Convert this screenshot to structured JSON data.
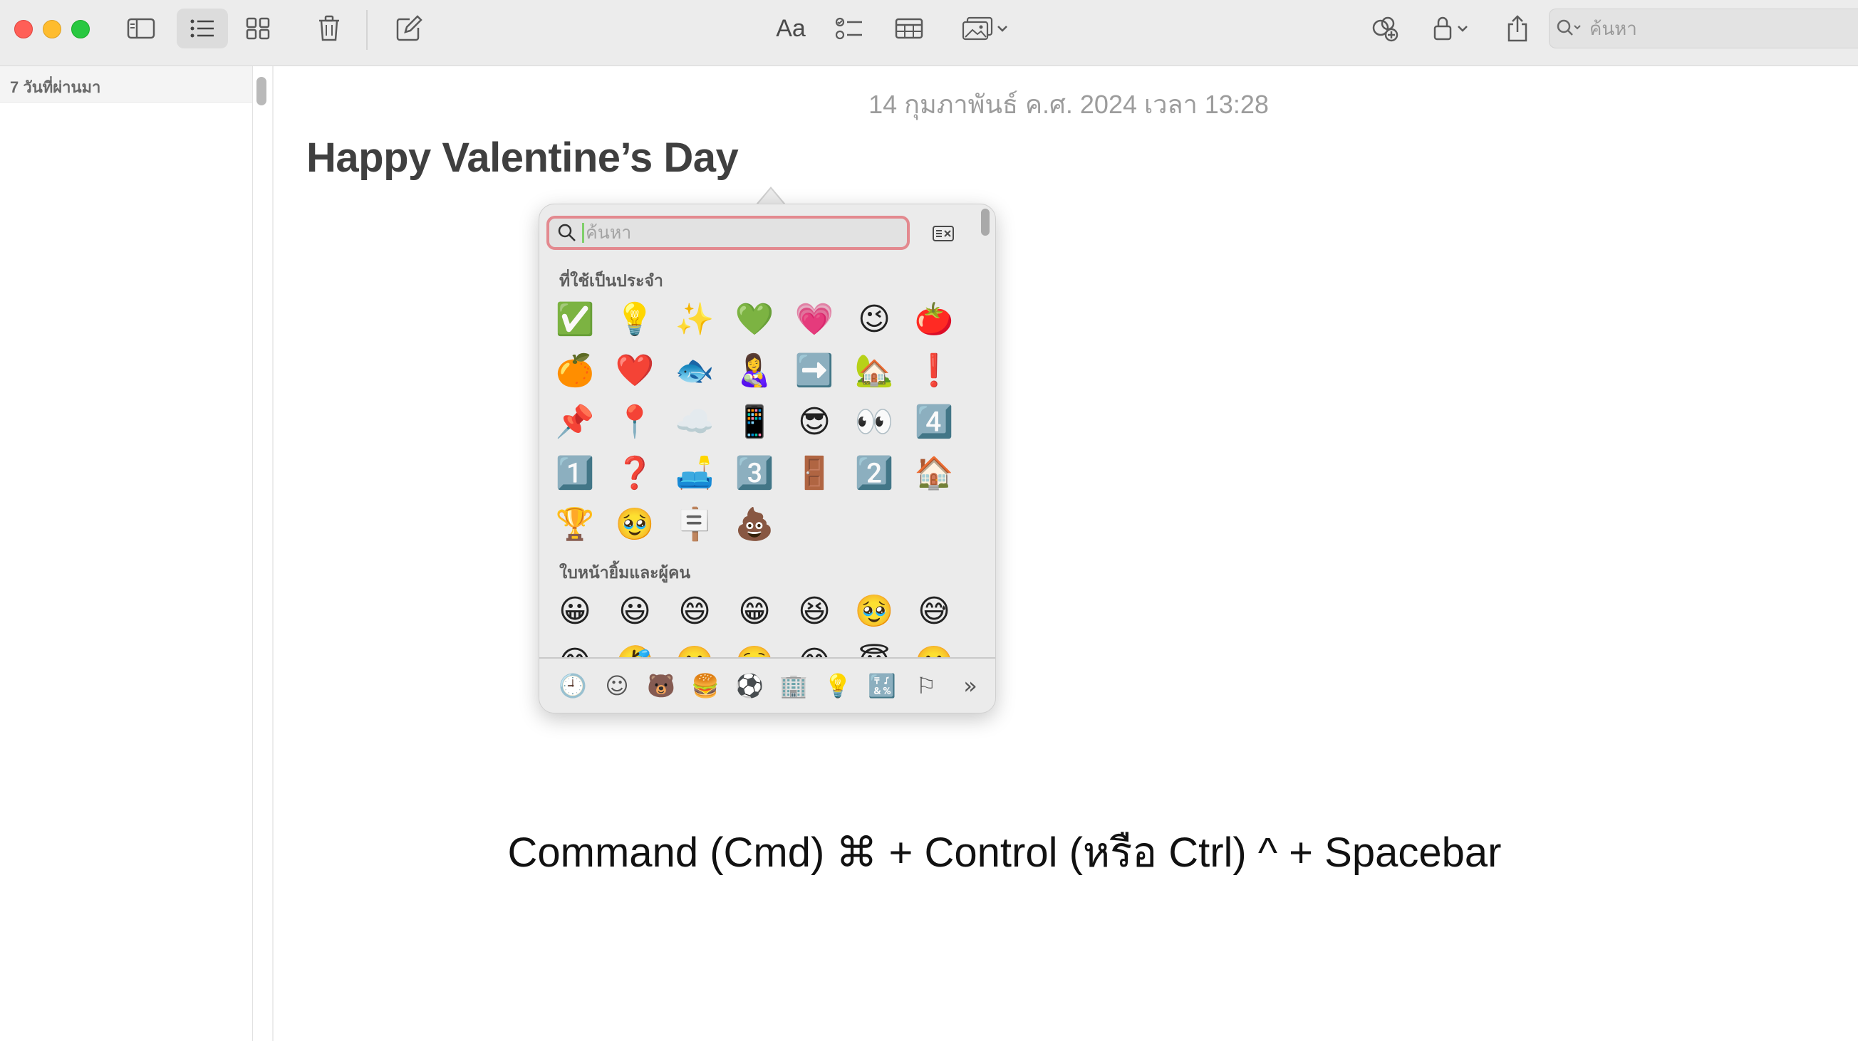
{
  "toolbar": {
    "search_placeholder": "ค้นหา",
    "format_label": "Aa"
  },
  "sidebar": {
    "section_header": "7 วันที่ผ่านมา"
  },
  "note": {
    "date": "14 กุมภาพันธ์ ค.ศ. 2024 เวลา 13:28",
    "title": "Happy Valentine’s Day",
    "shortcut_text": "Command (Cmd) ⌘ + Control (หรือ Ctrl) ^ + Spacebar"
  },
  "emoji_picker": {
    "search_placeholder": "ค้นหา",
    "sections": [
      {
        "label": "ที่ใช้เป็นประจำ",
        "emojis": [
          "✅",
          "💡",
          "✨",
          "💚",
          "💗",
          "😉",
          "🍅",
          "🍊",
          "❤️",
          "🐟",
          "👩‍🍼",
          "➡️",
          "🏡",
          "❗",
          "📌",
          "📍",
          "☁️",
          "📱",
          "😎",
          "👀",
          "4️⃣",
          "1️⃣",
          "❓",
          "🛋️",
          "3️⃣",
          "🚪",
          "2️⃣",
          "🏠",
          "🏆",
          "🥹",
          "🪧",
          "💩"
        ]
      },
      {
        "label": "ใบหน้ายิ้มและผู้คน",
        "emojis": [
          "😀",
          "😃",
          "😄",
          "😁",
          "😆",
          "🥹",
          "😅"
        ],
        "emojis_partial": [
          "😂",
          "🤣",
          "🥲",
          "☺️",
          "😊",
          "😇",
          "🙂"
        ]
      }
    ],
    "categories": [
      {
        "name": "recent",
        "glyph": "🕘"
      },
      {
        "name": "smileys",
        "glyph": "☺"
      },
      {
        "name": "animals",
        "glyph": "🐻"
      },
      {
        "name": "food",
        "glyph": "🍔"
      },
      {
        "name": "activity",
        "glyph": "⚽"
      },
      {
        "name": "travel",
        "glyph": "🏢"
      },
      {
        "name": "objects",
        "glyph": "💡"
      },
      {
        "name": "symbols",
        "glyph": "🔣"
      },
      {
        "name": "flags",
        "glyph": "⚐"
      },
      {
        "name": "more",
        "glyph": "»"
      }
    ]
  },
  "colors": {
    "toolbar_bg": "#ececec",
    "search_focus_ring": "#e3898f",
    "selected_category": "#d23a3a"
  }
}
